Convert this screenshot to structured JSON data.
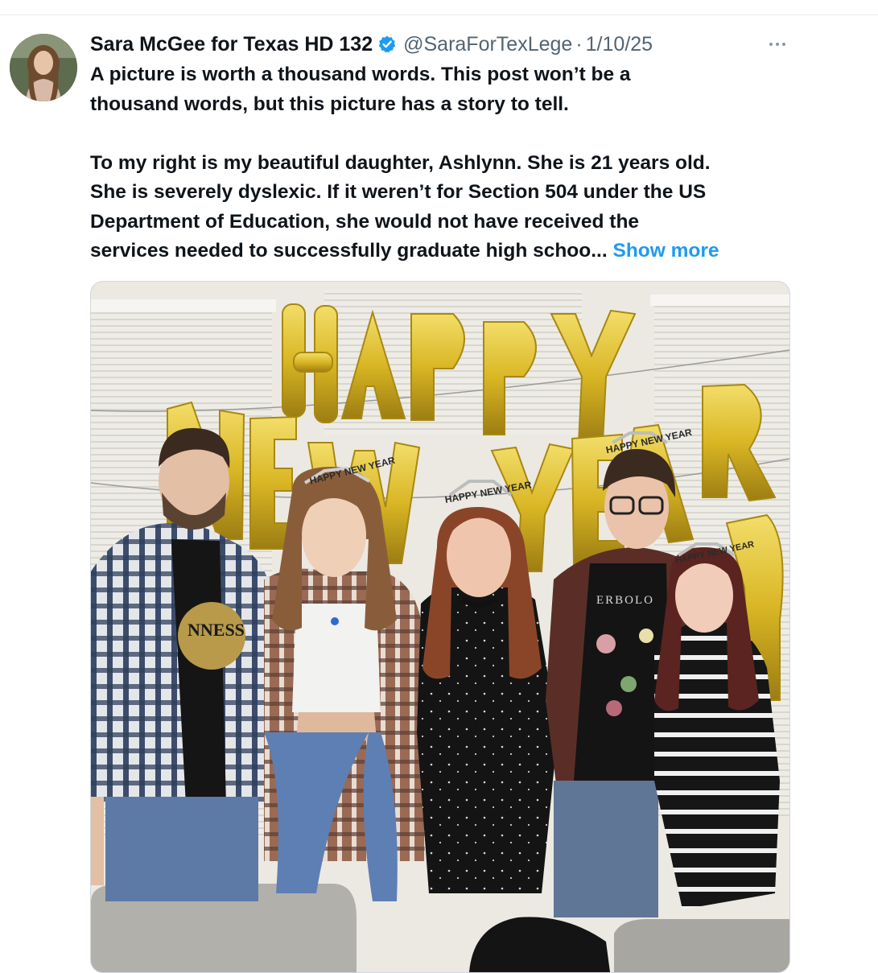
{
  "post": {
    "author": {
      "display_name": "Sara McGee for Texas HD 132",
      "handle": "@SaraForTexLege",
      "verified": true,
      "verified_color": "#1d9bf0"
    },
    "separator": "·",
    "date": "1/10/25",
    "more_icon": "more-horizontal-icon",
    "text": {
      "line1": "A picture is worth a thousand words. This post won’t be a",
      "line2": "thousand words, but this picture has a story to tell.",
      "line3": "To my right is my beautiful daughter, Ashlynn. She is 21 years old.",
      "line4": "She is severely dyslexic. If it weren’t for Section 504 under the US",
      "line5": "Department of Education, she would not have received the",
      "line6": "services needed to successfully graduate high schoo...",
      "show_more": "Show more"
    },
    "photo": {
      "balloons_top": "HAPPY",
      "balloons_bottom": "NEW YEAR",
      "tiara_text": "HAPPY NEW YEAR",
      "shirt_text_1": "NNESS",
      "shirt_text_2": "ERBOLO",
      "balloon_color": "#d9b624"
    }
  }
}
